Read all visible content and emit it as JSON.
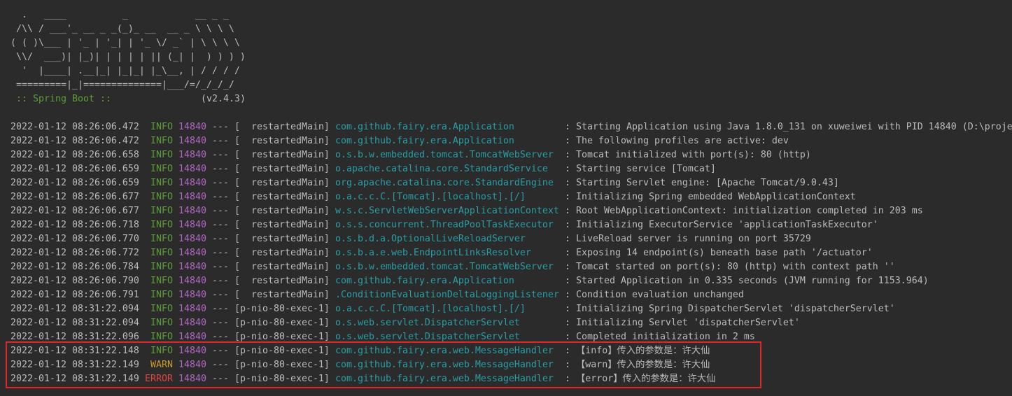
{
  "console": {
    "colors": {
      "background": "#2b2b2b",
      "text": "#bbbbbb",
      "banner_label": "#5c9e37",
      "levels": {
        "INFO": "#5c9e37",
        "WARN": "#c99a2e",
        "ERROR": "#e2463f"
      },
      "pid": "#b267c4",
      "logger": "#2a9ea5",
      "highlight": "#e0282b"
    },
    "banner": {
      "art": [
        "  .   ____          _            __ _ _",
        " /\\\\ / ___'_ __ _ _(_)_ __  __ _ \\ \\ \\ \\",
        "( ( )\\___ | '_ | '_| | '_ \\/ _` | \\ \\ \\ \\",
        " \\\\/  ___)| |_)| | | | | || (_| |  ) ) ) )",
        "  '  |____| .__|_| |_|_| |_\\__, | / / / /",
        " =========|_|==============|___/=/_/_/_/"
      ],
      "label": ":: Spring Boot ::",
      "version": "(v2.4.3)"
    },
    "separator": "---",
    "delimiter": ":",
    "logs": [
      {
        "ts": "2022-01-12 08:26:06.472",
        "level": "INFO",
        "pid": "14840",
        "thread": "[  restartedMain]",
        "logger": "com.github.fairy.era.Application",
        "msg": "Starting Application using Java 1.8.0_131 on xuweiwei with PID 14840 (D:\\proje"
      },
      {
        "ts": "2022-01-12 08:26:06.472",
        "level": "INFO",
        "pid": "14840",
        "thread": "[  restartedMain]",
        "logger": "com.github.fairy.era.Application",
        "msg": "The following profiles are active: dev"
      },
      {
        "ts": "2022-01-12 08:26:06.658",
        "level": "INFO",
        "pid": "14840",
        "thread": "[  restartedMain]",
        "logger": "o.s.b.w.embedded.tomcat.TomcatWebServer",
        "msg": "Tomcat initialized with port(s): 80 (http)"
      },
      {
        "ts": "2022-01-12 08:26:06.659",
        "level": "INFO",
        "pid": "14840",
        "thread": "[  restartedMain]",
        "logger": "o.apache.catalina.core.StandardService",
        "msg": "Starting service [Tomcat]"
      },
      {
        "ts": "2022-01-12 08:26:06.659",
        "level": "INFO",
        "pid": "14840",
        "thread": "[  restartedMain]",
        "logger": "org.apache.catalina.core.StandardEngine",
        "msg": "Starting Servlet engine: [Apache Tomcat/9.0.43]"
      },
      {
        "ts": "2022-01-12 08:26:06.677",
        "level": "INFO",
        "pid": "14840",
        "thread": "[  restartedMain]",
        "logger": "o.a.c.c.C.[Tomcat].[localhost].[/]",
        "msg": "Initializing Spring embedded WebApplicationContext"
      },
      {
        "ts": "2022-01-12 08:26:06.677",
        "level": "INFO",
        "pid": "14840",
        "thread": "[  restartedMain]",
        "logger": "w.s.c.ServletWebServerApplicationContext",
        "msg": "Root WebApplicationContext: initialization completed in 203 ms"
      },
      {
        "ts": "2022-01-12 08:26:06.718",
        "level": "INFO",
        "pid": "14840",
        "thread": "[  restartedMain]",
        "logger": "o.s.s.concurrent.ThreadPoolTaskExecutor",
        "msg": "Initializing ExecutorService 'applicationTaskExecutor'"
      },
      {
        "ts": "2022-01-12 08:26:06.770",
        "level": "INFO",
        "pid": "14840",
        "thread": "[  restartedMain]",
        "logger": "o.s.b.d.a.OptionalLiveReloadServer",
        "msg": "LiveReload server is running on port 35729"
      },
      {
        "ts": "2022-01-12 08:26:06.772",
        "level": "INFO",
        "pid": "14840",
        "thread": "[  restartedMain]",
        "logger": "o.s.b.a.e.web.EndpointLinksResolver",
        "msg": "Exposing 14 endpoint(s) beneath base path '/actuator'"
      },
      {
        "ts": "2022-01-12 08:26:06.784",
        "level": "INFO",
        "pid": "14840",
        "thread": "[  restartedMain]",
        "logger": "o.s.b.w.embedded.tomcat.TomcatWebServer",
        "msg": "Tomcat started on port(s): 80 (http) with context path ''"
      },
      {
        "ts": "2022-01-12 08:26:06.790",
        "level": "INFO",
        "pid": "14840",
        "thread": "[  restartedMain]",
        "logger": "com.github.fairy.era.Application",
        "msg": "Started Application in 0.335 seconds (JVM running for 1153.964)"
      },
      {
        "ts": "2022-01-12 08:26:06.791",
        "level": "INFO",
        "pid": "14840",
        "thread": "[  restartedMain]",
        "logger": ".ConditionEvaluationDeltaLoggingListener",
        "msg": "Condition evaluation unchanged"
      },
      {
        "ts": "2022-01-12 08:31:22.094",
        "level": "INFO",
        "pid": "14840",
        "thread": "[p-nio-80-exec-1]",
        "logger": "o.a.c.c.C.[Tomcat].[localhost].[/]",
        "msg": "Initializing Spring DispatcherServlet 'dispatcherServlet'"
      },
      {
        "ts": "2022-01-12 08:31:22.094",
        "level": "INFO",
        "pid": "14840",
        "thread": "[p-nio-80-exec-1]",
        "logger": "o.s.web.servlet.DispatcherServlet",
        "msg": "Initializing Servlet 'dispatcherServlet'"
      },
      {
        "ts": "2022-01-12 08:31:22.096",
        "level": "INFO",
        "pid": "14840",
        "thread": "[p-nio-80-exec-1]",
        "logger": "o.s.web.servlet.DispatcherServlet",
        "msg": "Completed initialization in 2 ms"
      },
      {
        "ts": "2022-01-12 08:31:22.148",
        "level": "INFO",
        "pid": "14840",
        "thread": "[p-nio-80-exec-1]",
        "logger": "com.github.fairy.era.web.MessageHandler",
        "msg": "【info】传入的参数是：许大仙",
        "highlighted": true
      },
      {
        "ts": "2022-01-12 08:31:22.149",
        "level": "WARN",
        "pid": "14840",
        "thread": "[p-nio-80-exec-1]",
        "logger": "com.github.fairy.era.web.MessageHandler",
        "msg": "【warn】传入的参数是：许大仙",
        "highlighted": true
      },
      {
        "ts": "2022-01-12 08:31:22.149",
        "level": "ERROR",
        "pid": "14840",
        "thread": "[p-nio-80-exec-1]",
        "logger": "com.github.fairy.era.web.MessageHandler",
        "msg": "【error】传入的参数是：许大仙",
        "highlighted": true
      }
    ]
  }
}
